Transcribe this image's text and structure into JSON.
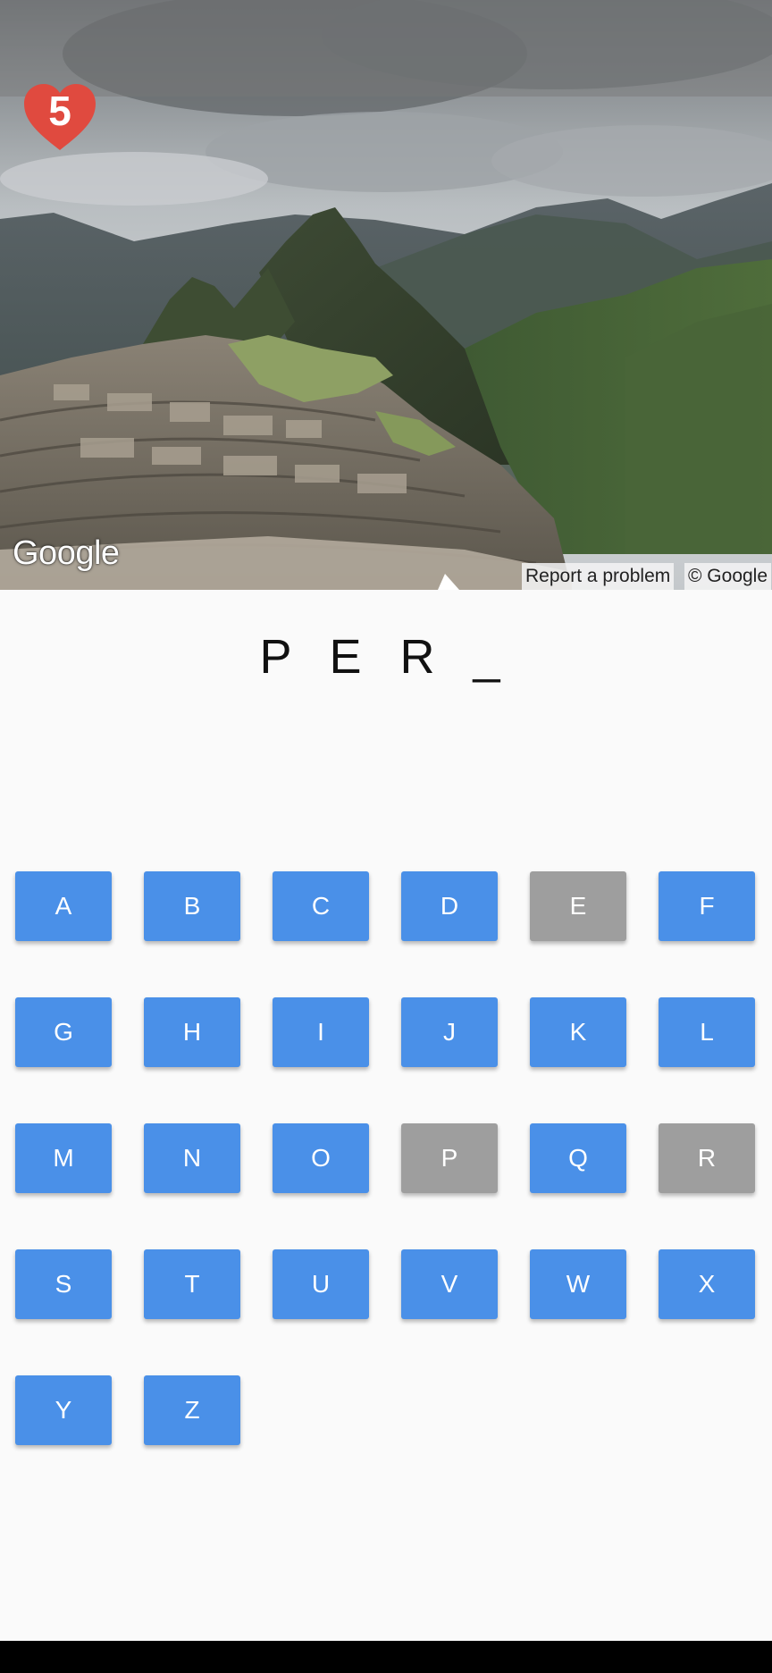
{
  "game": {
    "lives": "5",
    "word": "P E R _"
  },
  "streetview": {
    "logo_text": "Google",
    "report_link": "Report a problem",
    "copyright": "© Google"
  },
  "keyboard": {
    "keys": [
      {
        "letter": "A",
        "used": false
      },
      {
        "letter": "B",
        "used": false
      },
      {
        "letter": "C",
        "used": false
      },
      {
        "letter": "D",
        "used": false
      },
      {
        "letter": "E",
        "used": true
      },
      {
        "letter": "F",
        "used": false
      },
      {
        "letter": "G",
        "used": false
      },
      {
        "letter": "H",
        "used": false
      },
      {
        "letter": "I",
        "used": false
      },
      {
        "letter": "J",
        "used": false
      },
      {
        "letter": "K",
        "used": false
      },
      {
        "letter": "L",
        "used": false
      },
      {
        "letter": "M",
        "used": false
      },
      {
        "letter": "N",
        "used": false
      },
      {
        "letter": "O",
        "used": false
      },
      {
        "letter": "P",
        "used": true
      },
      {
        "letter": "Q",
        "used": false
      },
      {
        "letter": "R",
        "used": true
      },
      {
        "letter": "S",
        "used": false
      },
      {
        "letter": "T",
        "used": false
      },
      {
        "letter": "U",
        "used": false
      },
      {
        "letter": "V",
        "used": false
      },
      {
        "letter": "W",
        "used": false
      },
      {
        "letter": "X",
        "used": false
      },
      {
        "letter": "Y",
        "used": false
      },
      {
        "letter": "Z",
        "used": false
      }
    ]
  },
  "colors": {
    "key_active": "#4a90e8",
    "key_used": "#9e9e9e",
    "heart": "#e04a3f",
    "background": "#fafafa"
  },
  "icons": {
    "lives": "heart-icon",
    "pegman_pointer": "triangle-pointer-icon"
  }
}
